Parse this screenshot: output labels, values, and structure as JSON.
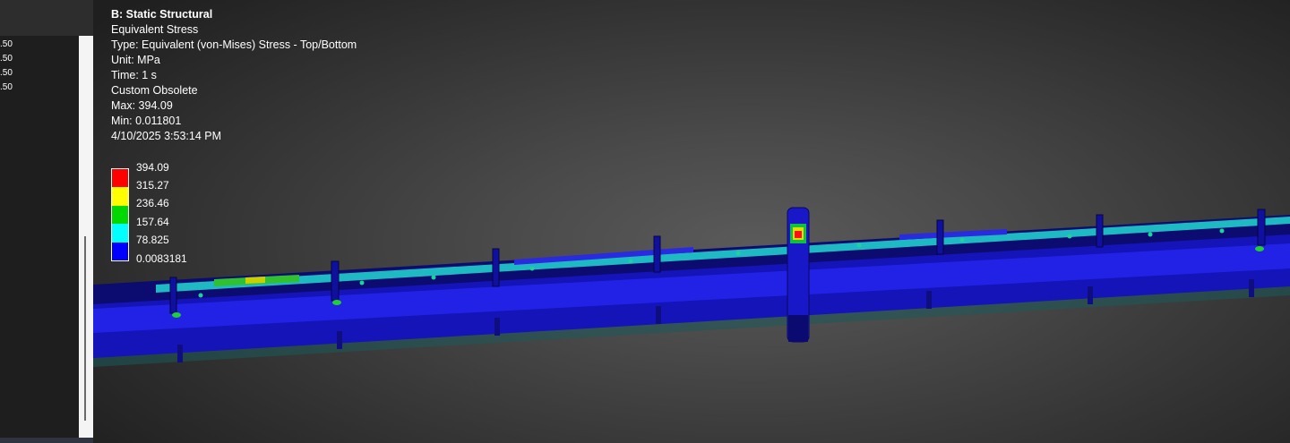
{
  "left_panel": {
    "values": [
      ".50",
      ".50",
      ".50",
      ".50"
    ]
  },
  "result": {
    "title": "B: Static Structural",
    "name": "Equivalent Stress",
    "type": "Type: Equivalent (von-Mises) Stress - Top/Bottom",
    "unit": "Unit: MPa",
    "time": "Time: 1 s",
    "custom": "Custom Obsolete",
    "max": "Max: 394.09",
    "min": "Min: 0.011801",
    "timestamp": "4/10/2025 3:53:14 PM"
  },
  "legend": {
    "labels": [
      "394.09",
      "315.27",
      "236.46",
      "157.64",
      "78.825",
      "0.0083181"
    ],
    "colors": [
      "#ff0000",
      "#ffff00",
      "#00d800",
      "#00ffff",
      "#0000ff"
    ]
  },
  "colors": {
    "beam_body": "#1a1ad8",
    "beam_dark": "#0d0d8a",
    "beam_top": "#1fc0c8",
    "beam_edge": "#0a0a55"
  }
}
